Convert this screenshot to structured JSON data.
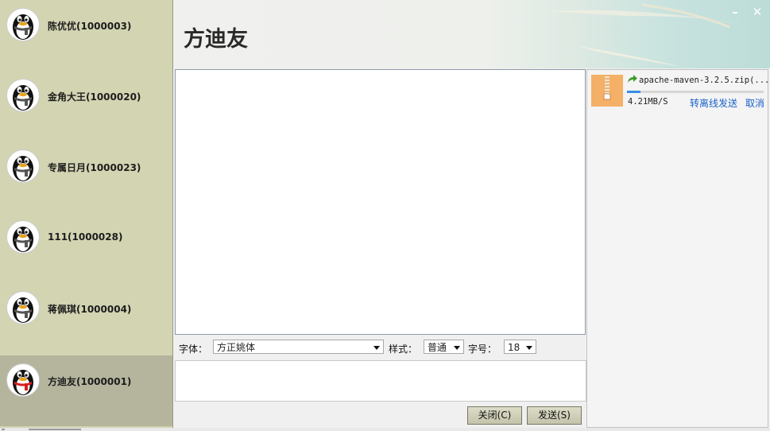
{
  "contacts": [
    {
      "name": "陈优优(1000003)",
      "selected": false
    },
    {
      "name": "金角大王(1000020)",
      "selected": false
    },
    {
      "name": "专属日月(1000023)",
      "selected": false
    },
    {
      "name": "111(1000028)",
      "selected": false
    },
    {
      "name": "蒋佩琪(1000004)",
      "selected": false
    },
    {
      "name": "方迪友(1000001)",
      "selected": true
    }
  ],
  "avatar_icon": "qq-penguin-icon",
  "chat": {
    "title": "方迪友",
    "minimize_glyph": "–",
    "close_glyph": "✕"
  },
  "toolbar": {
    "font_label": "字体：",
    "font_value": "方正姚体",
    "style_label": "样式：",
    "style_value": "普通",
    "size_label": "字号：",
    "size_value": "18"
  },
  "buttons": {
    "close_label": "关闭(C)",
    "send_label": "发送(S)"
  },
  "transfer": {
    "file_name": "apache-maven-3.2.5.zip(...",
    "speed": "4.21MB/S",
    "progress": 0.1,
    "offline_send_label": "转离线发送",
    "cancel_label": "取消",
    "file_icon": "zip-file-icon"
  },
  "colors": {
    "sidebar_bg": "#d3d4b2",
    "selected_bg": "#b5b59e",
    "link": "#1a62c8",
    "progress": "#3a8ee6",
    "file_icon": "#f4b066"
  }
}
